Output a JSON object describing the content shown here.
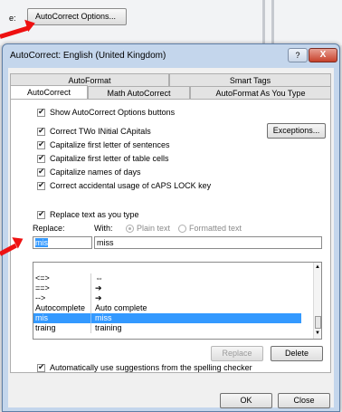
{
  "background": {
    "label_fragment": "e:",
    "autocorrect_options_button": "AutoCorrect Options..."
  },
  "dialog": {
    "title": "AutoCorrect: English (United Kingdom)",
    "help_glyph": "?",
    "close_glyph": "X"
  },
  "tabs": {
    "row1": [
      "AutoFormat",
      "Smart Tags"
    ],
    "row2": [
      "AutoCorrect",
      "Math AutoCorrect",
      "AutoFormat As You Type"
    ],
    "active": "AutoCorrect"
  },
  "options": {
    "show_buttons": {
      "label": "Show AutoCorrect Options buttons",
      "checked": true
    },
    "two_initial_caps": {
      "label": "Correct TWo INitial CApitals",
      "checked": true
    },
    "first_letter_sentences": {
      "label": "Capitalize first letter of sentences",
      "checked": true
    },
    "first_letter_table_cells": {
      "label": "Capitalize first letter of table cells",
      "checked": true
    },
    "names_of_days": {
      "label": "Capitalize names of days",
      "checked": true
    },
    "caps_lock": {
      "label": "Correct accidental usage of cAPS LOCK key",
      "checked": true
    },
    "exceptions_button": "Exceptions...",
    "replace_as_you_type": {
      "label": "Replace text as you type",
      "checked": true
    },
    "replace_label": "Replace:",
    "with_label": "With:",
    "plain_text_label": "Plain text",
    "formatted_text_label": "Formatted text",
    "replace_value": "mis",
    "with_value": "miss",
    "suggestions": {
      "label": "Automatically use suggestions from the spelling checker",
      "checked": true
    }
  },
  "entries": [
    {
      "replace": "<=>",
      "with": "⇔",
      "selected": false
    },
    {
      "replace": "==>",
      "with": "➔",
      "selected": false
    },
    {
      "replace": "-->",
      "with": "➔",
      "selected": false
    },
    {
      "replace": "Autocomplete",
      "with": "Auto complete",
      "selected": false
    },
    {
      "replace": "mis",
      "with": "miss",
      "selected": true
    },
    {
      "replace": "traing",
      "with": "training",
      "selected": false
    }
  ],
  "buttons": {
    "replace": "Replace",
    "delete": "Delete",
    "ok": "OK",
    "close": "Close"
  },
  "colors": {
    "accent": "#3399ff",
    "annotation_arrow": "#e11111"
  }
}
